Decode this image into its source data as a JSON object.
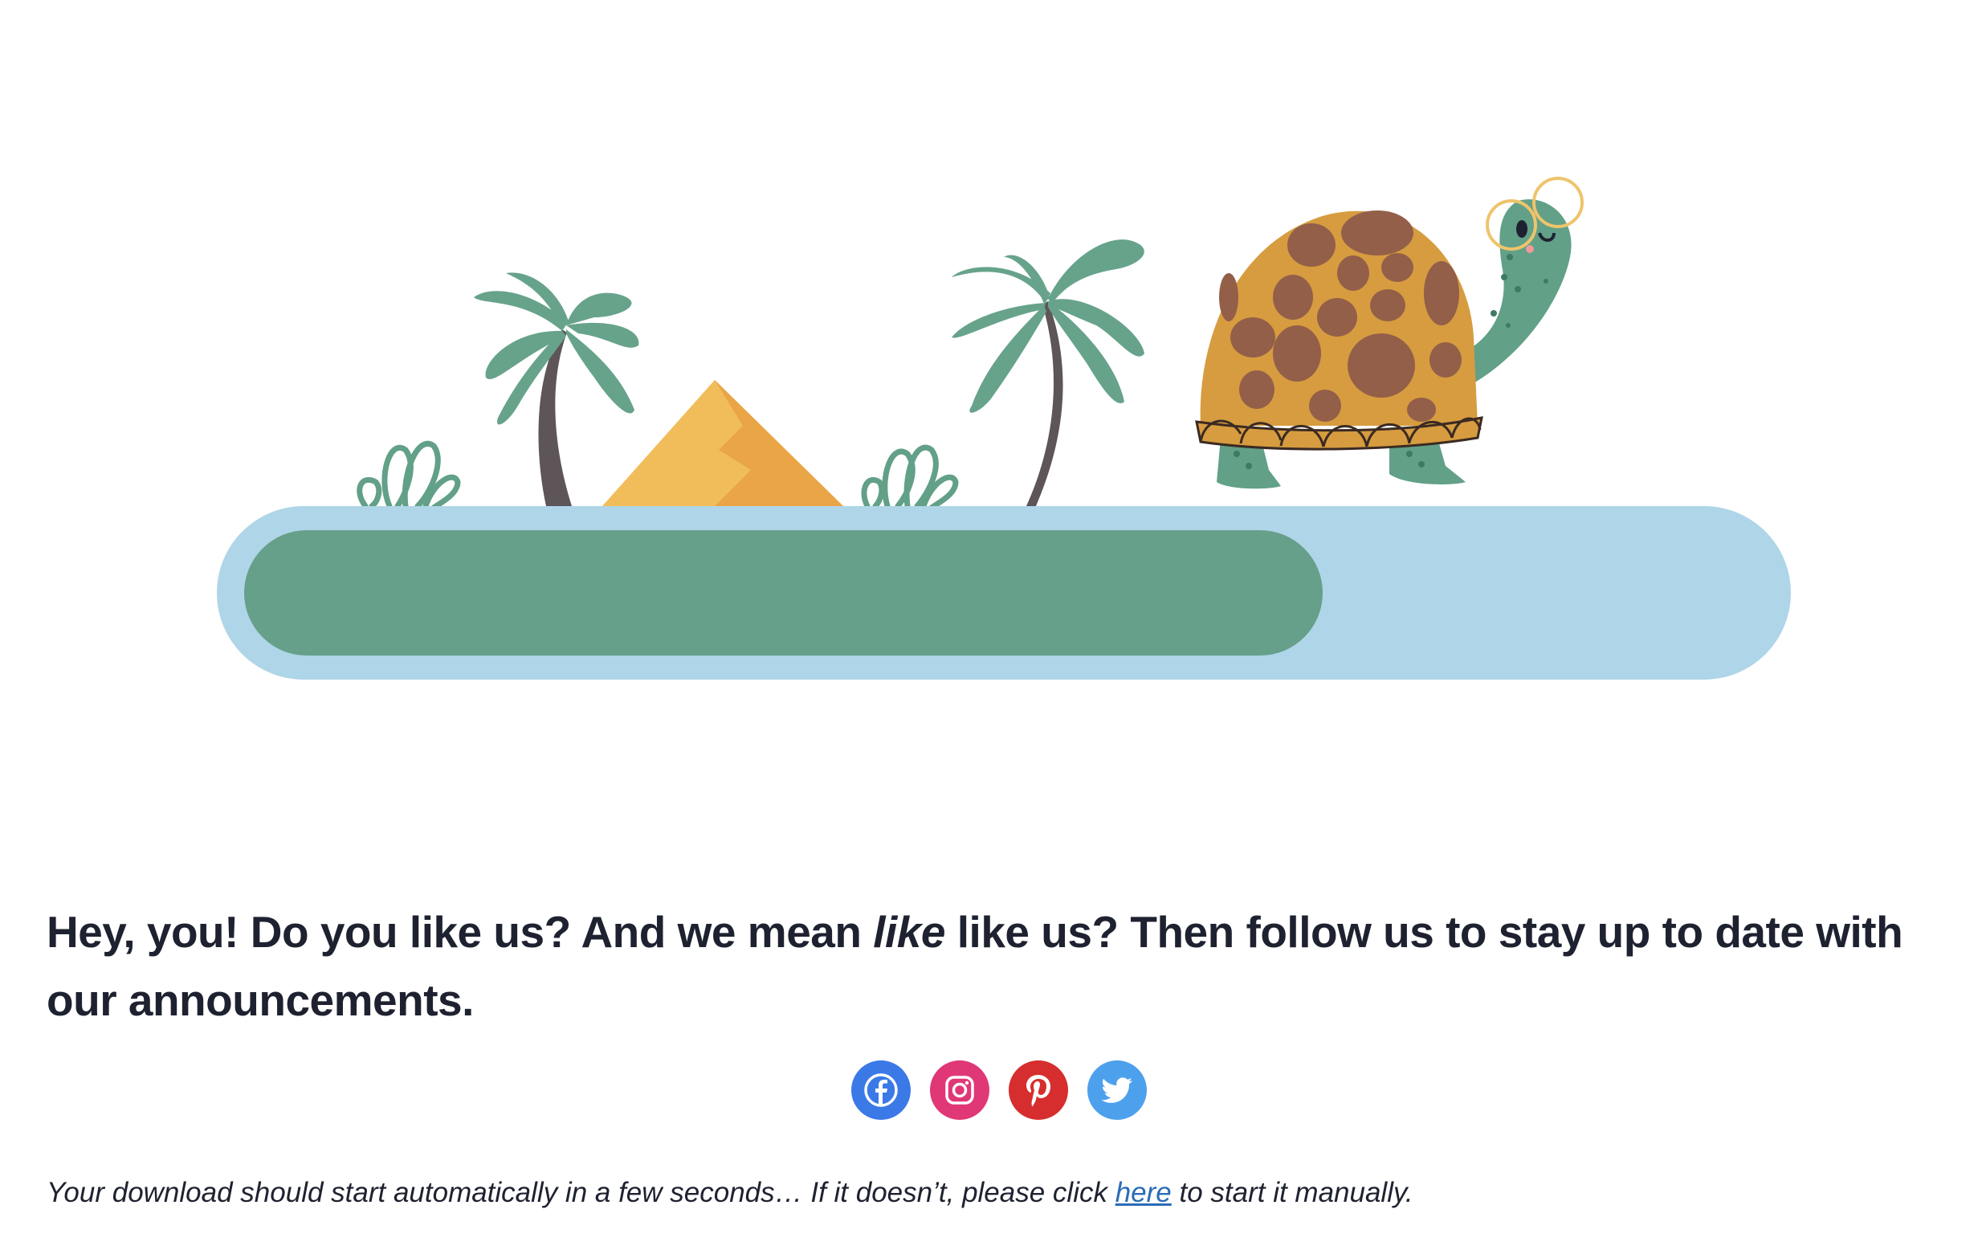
{
  "illustration": {
    "description_icons": [
      "palm-tree-icon",
      "pyramid-icon",
      "bush-icon",
      "turtle-icon"
    ],
    "progress": 0.71,
    "colors": {
      "track": "#afd5e8",
      "fill": "#669f8a",
      "palm_leaf": "#67a38b",
      "trunk": "#5e5558",
      "pyramid_light": "#f1bd5a",
      "pyramid_dark": "#e9a546",
      "shell": "#d69c3f",
      "shell_spots": "#935f49",
      "turtle_skin": "#62a088",
      "glasses": "#eec46c"
    }
  },
  "headline": {
    "part1": "Hey, you! Do you like us? And we mean ",
    "emphasis": "like",
    "part2": " like us? Then follow us to stay up to date with our announcements."
  },
  "social": [
    {
      "name": "Facebook",
      "icon": "facebook-icon",
      "color": "#3b79e7"
    },
    {
      "name": "Instagram",
      "icon": "instagram-icon",
      "color": "#e03777"
    },
    {
      "name": "Pinterest",
      "icon": "pinterest-icon",
      "color": "#d62e2e"
    },
    {
      "name": "Twitter",
      "icon": "twitter-icon",
      "color": "#4da1ec"
    }
  ],
  "download_note": {
    "before": "Your download should start automatically in a few seconds… If it doesn’t, please click ",
    "link": "here",
    "after": " to start it manually."
  }
}
